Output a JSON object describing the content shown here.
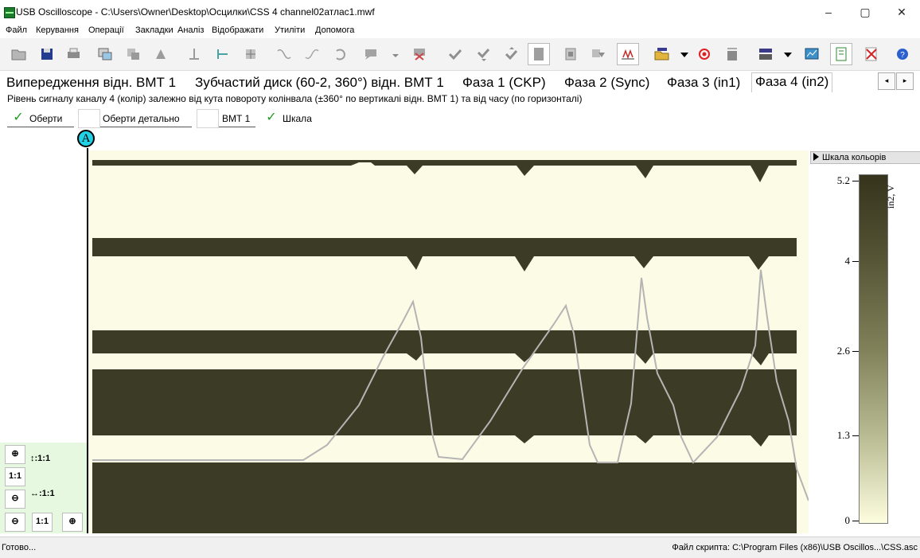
{
  "window": {
    "title": "USB Oscilloscope - C:\\Users\\Owner\\Desktop\\Осцилки\\CSS 4 channel02атлас1.mwf",
    "minimize": "–",
    "maximize": "▢",
    "close": "✕"
  },
  "menu": [
    "Файл",
    "Керування",
    "Операції",
    "Закладки",
    "Аналіз",
    "Відображати",
    "Утиліти",
    "Допомога"
  ],
  "toolbar": {
    "icons": [
      "open-folder",
      "save",
      "print",
      "copy-screen",
      "copy",
      "paste",
      "cursor-vertical",
      "cursor-horizontal",
      "measure",
      "filter-low",
      "filter-high",
      "undo",
      "comment",
      "dropdown-arrow",
      "delete-comment",
      "check",
      "check-down",
      "check-up",
      "page",
      "stop-page",
      "export",
      "spectrum",
      "open-script",
      "dropdown-arrow",
      "record",
      "run-script",
      "script-setup",
      "dropdown-arrow",
      "screen-graph",
      "page-view",
      "cancel",
      "help"
    ]
  },
  "tabs": [
    {
      "label": "Випередження відн. ВМТ 1",
      "active": false
    },
    {
      "label": "Зубчастий диск (60-2, 360°) відн. ВМТ 1",
      "active": false
    },
    {
      "label": "Фаза 1 (CKP)",
      "active": false
    },
    {
      "label": "Фаза 2 (Sync)",
      "active": false
    },
    {
      "label": "Фаза 3 (in1)",
      "active": false
    },
    {
      "label": "Фаза 4 (in2)",
      "active": true
    }
  ],
  "tab_scroll": {
    "left": "◂",
    "right": "▸"
  },
  "description": "Рівень сигналу каналу 4 (колір) залежно від кута повороту колінвала (±360° по вертикалі відн. ВМТ 1) та від часу (по горизонталі)",
  "options": [
    {
      "label": "Оберти",
      "checked": true
    },
    {
      "label": "Оберти детально",
      "checked": false
    },
    {
      "label": "ВМТ 1",
      "checked": false
    },
    {
      "label": "Шкала",
      "checked": true
    }
  ],
  "check_mark": "✓",
  "marker_label": "A",
  "zoom": {
    "plus": "⊕",
    "minus": "⊖",
    "reset": "1:1",
    "vertical_ratio": "↕:1:1",
    "horizontal_ratio": "↔:1:1"
  },
  "color_scale": {
    "header": "Шкала кольорів",
    "unit": "in2, V",
    "ticks": [
      "5.2",
      "4",
      "2.6",
      "1.3",
      "0"
    ],
    "colors": [
      "#35331b",
      "#575637",
      "#808159",
      "#b9bb92",
      "#fdfddf"
    ]
  },
  "heatmap": {
    "dark_color": "#3c3b25",
    "light_color": "#fcfbe5",
    "trace_color": "#b4b4b4"
  },
  "status": {
    "left": "Готово...",
    "right": "Файл скрипта: C:\\Program Files (x86)\\USB Oscillos...\\CSS.asc"
  }
}
